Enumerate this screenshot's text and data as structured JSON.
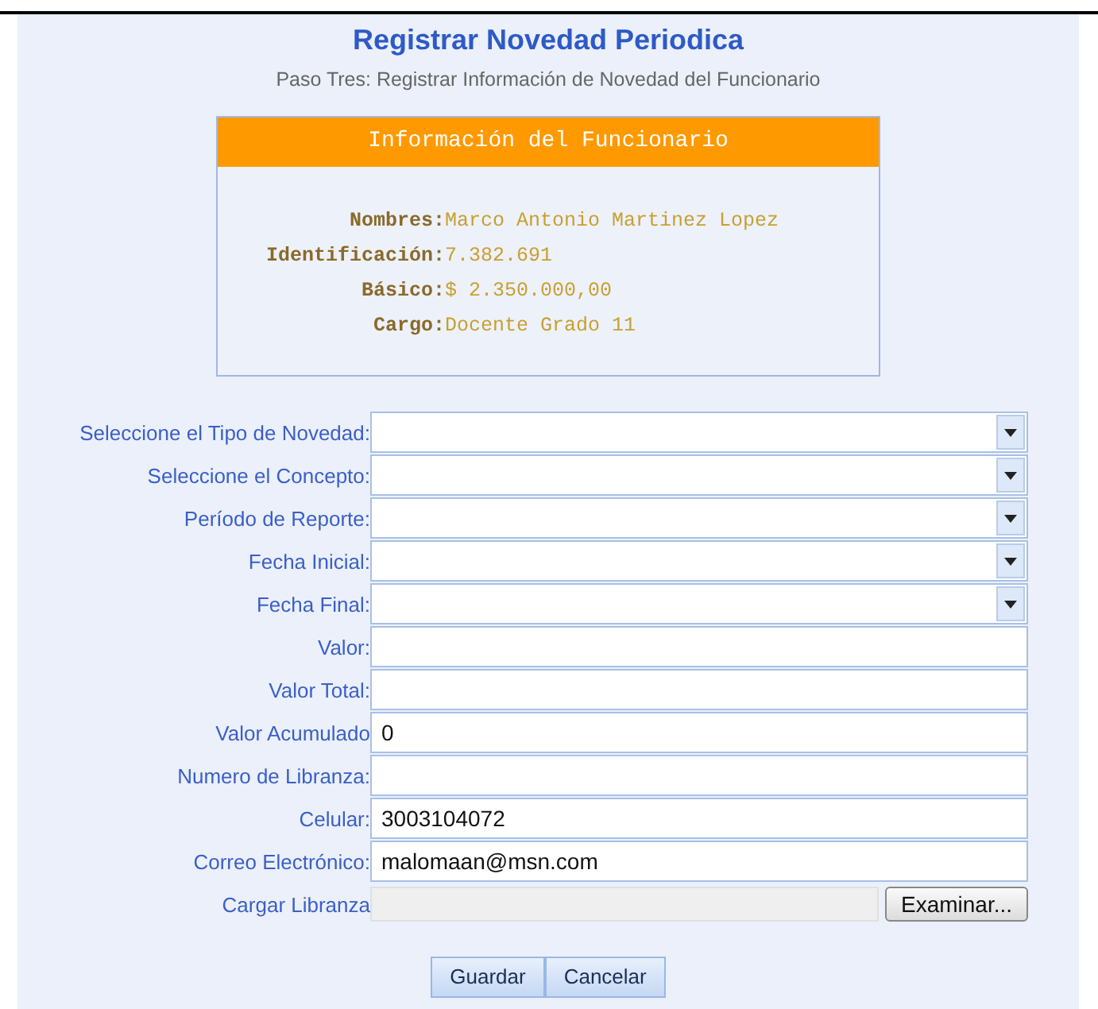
{
  "header": {
    "title": "Registrar Novedad Periodica",
    "subtitle": "Paso Tres: Registrar Información de Novedad del Funcionario"
  },
  "info_card": {
    "title": "Información del Funcionario",
    "rows": [
      {
        "label": "Nombres:",
        "value": "Marco Antonio Martinez Lopez"
      },
      {
        "label": "Identificación:",
        "value": "7.382.691"
      },
      {
        "label": "Básico:",
        "value": "$ 2.350.000,00"
      },
      {
        "label": "Cargo:",
        "value": "Docente Grado 11"
      }
    ]
  },
  "form": {
    "fields": [
      {
        "kind": "select",
        "label": "Seleccione el Tipo de Novedad:"
      },
      {
        "kind": "select",
        "label": "Seleccione el Concepto:"
      },
      {
        "kind": "select",
        "label": "Período de Reporte:"
      },
      {
        "kind": "select",
        "label": "Fecha Inicial:"
      },
      {
        "kind": "select",
        "label": "Fecha Final:"
      },
      {
        "kind": "text",
        "label": "Valor:"
      },
      {
        "kind": "text",
        "label": "Valor Total:"
      },
      {
        "kind": "text",
        "label": "Valor Acumulado",
        "value": "0"
      },
      {
        "kind": "text",
        "label": "Numero de Libranza:"
      },
      {
        "kind": "text",
        "label": "Celular:",
        "value": "3003104072"
      },
      {
        "kind": "text",
        "label": "Correo Electrónico:",
        "value": "malomaan@msn.com"
      },
      {
        "kind": "file",
        "label": "Cargar Libranza",
        "button": "Examinar..."
      }
    ]
  },
  "buttons": [
    "Guardar",
    "Cancelar"
  ]
}
